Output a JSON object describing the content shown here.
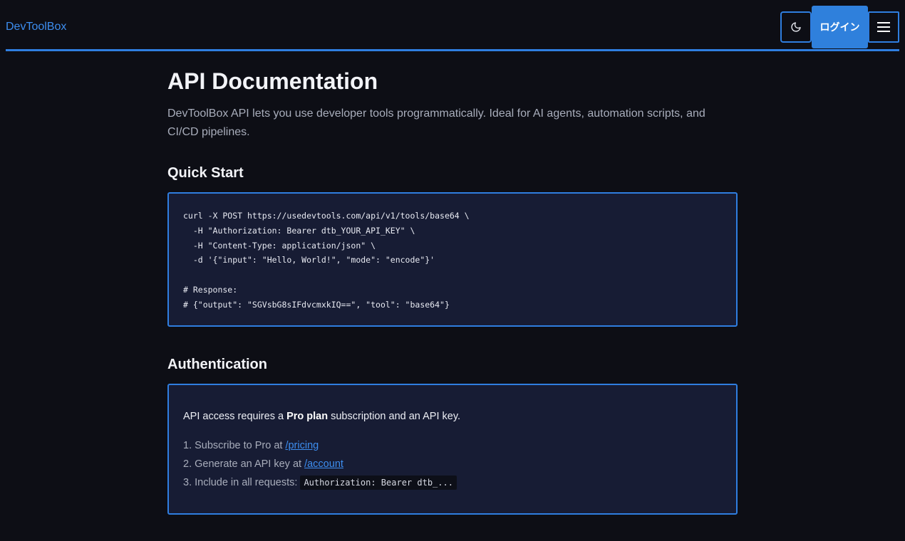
{
  "header": {
    "brand": "DevToolBox",
    "login_label": "ログイン"
  },
  "main": {
    "title": "API Documentation",
    "intro": "DevToolBox API lets you use developer tools programmatically. Ideal for AI agents, automation scripts, and CI/CD pipelines.",
    "quick_start": {
      "heading": "Quick Start",
      "code": "curl -X POST https://usedevtools.com/api/v1/tools/base64 \\\n  -H \"Authorization: Bearer dtb_YOUR_API_KEY\" \\\n  -H \"Content-Type: application/json\" \\\n  -d '{\"input\": \"Hello, World!\", \"mode\": \"encode\"}'\n\n# Response:\n# {\"output\": \"SGVsbG8sIFdvcmxkIQ==\", \"tool\": \"base64\"}"
    },
    "authentication": {
      "heading": "Authentication",
      "text_before": "API access requires a ",
      "text_bold": "Pro plan",
      "text_after": " subscription and an API key.",
      "steps": [
        {
          "num": "1.",
          "text": "Subscribe to Pro at ",
          "link": "/pricing"
        },
        {
          "num": "2.",
          "text": "Generate an API key at ",
          "link": "/account"
        },
        {
          "num": "3.",
          "text": "Include in all requests: ",
          "code": "Authorization: Bearer dtb_..."
        }
      ]
    }
  },
  "colors": {
    "background": "#0d0e15",
    "accent": "#2f7ee0",
    "panel": "#171c34"
  },
  "icons": {
    "theme_toggle": "moon-icon",
    "menu": "hamburger-menu-icon"
  }
}
